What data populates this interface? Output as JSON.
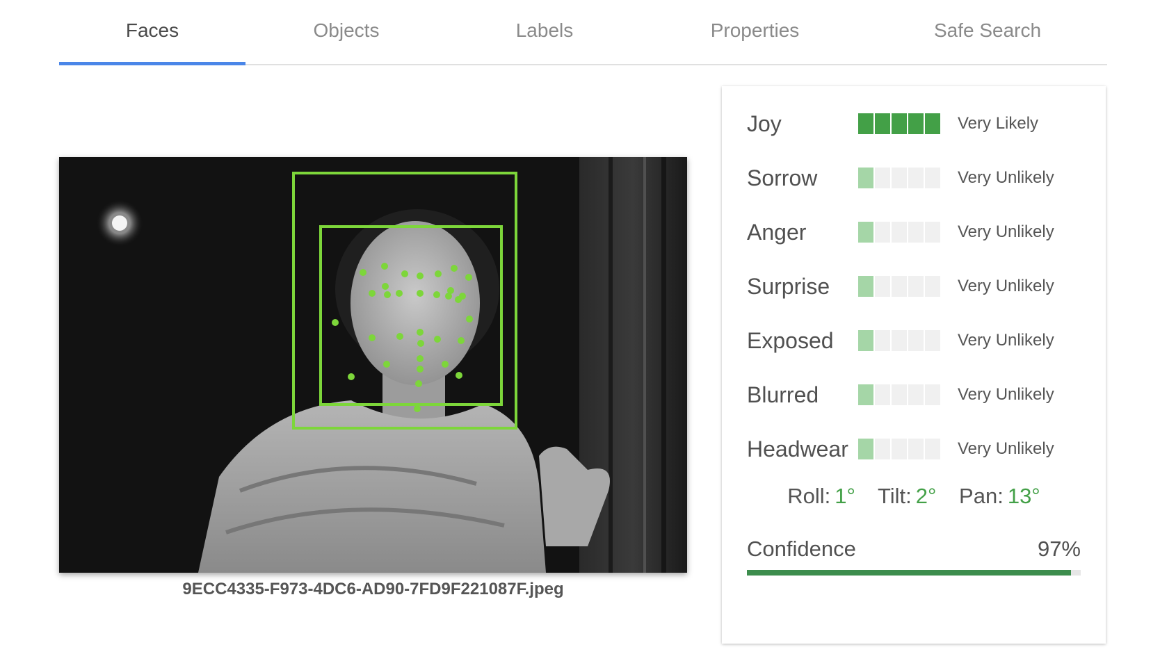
{
  "tabs": [
    {
      "label": "Faces",
      "active": true
    },
    {
      "label": "Objects",
      "active": false
    },
    {
      "label": "Labels",
      "active": false
    },
    {
      "label": "Properties",
      "active": false
    },
    {
      "label": "Safe Search",
      "active": false
    }
  ],
  "image": {
    "filename": "9ECC4335-F973-4DC6-AD90-7FD9F221087F.jpeg"
  },
  "attributes": [
    {
      "name": "Joy",
      "likelihood": "Very Likely",
      "level": 5
    },
    {
      "name": "Sorrow",
      "likelihood": "Very Unlikely",
      "level": 1
    },
    {
      "name": "Anger",
      "likelihood": "Very Unlikely",
      "level": 1
    },
    {
      "name": "Surprise",
      "likelihood": "Very Unlikely",
      "level": 1
    },
    {
      "name": "Exposed",
      "likelihood": "Very Unlikely",
      "level": 1
    },
    {
      "name": "Blurred",
      "likelihood": "Very Unlikely",
      "level": 1
    },
    {
      "name": "Headwear",
      "likelihood": "Very Unlikely",
      "level": 1
    }
  ],
  "angles": {
    "roll_label": "Roll:",
    "roll": "1°",
    "tilt_label": "Tilt:",
    "tilt": "2°",
    "pan_label": "Pan:",
    "pan": "13°"
  },
  "confidence": {
    "label": "Confidence",
    "value_text": "97%",
    "fraction": 0.97
  },
  "colors": {
    "accent": "#4a86e8",
    "likely": "#43a047",
    "unlikely": "#a5d6a7",
    "overlay": "#7dd63a"
  }
}
